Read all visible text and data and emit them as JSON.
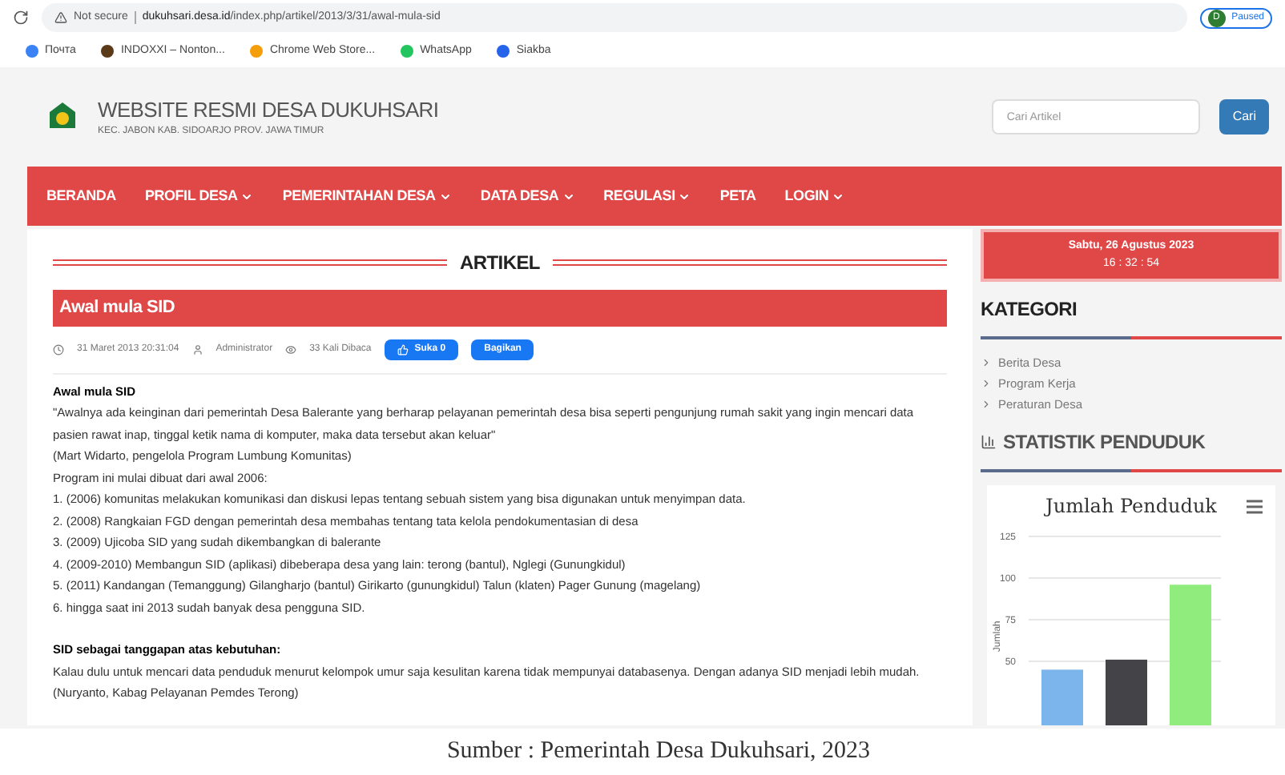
{
  "browser": {
    "security": "Not secure",
    "url_host": "dukuhsari.desa.id",
    "url_path": "/index.php/artikel/2013/3/31/awal-mula-sid",
    "profile_initial": "D",
    "profile_status": "Paused",
    "bookmarks": [
      {
        "label": "Почта",
        "color": "#3b82f6"
      },
      {
        "label": "INDOXXI – Nonton...",
        "color": "#5b3a1a"
      },
      {
        "label": "Chrome Web Store...",
        "color": "#f59e0b"
      },
      {
        "label": "WhatsApp",
        "color": "#22c55e"
      },
      {
        "label": "Siakba",
        "color": "#2563eb"
      }
    ]
  },
  "site": {
    "title": "WEBSITE RESMI DESA DUKUHSARI",
    "subtitle": "KEC. JABON KAB. SIDOARJO PROV. JAWA TIMUR",
    "search": {
      "placeholder": "Cari Artikel",
      "button": "Cari"
    }
  },
  "nav": [
    {
      "label": "BERANDA",
      "dropdown": false
    },
    {
      "label": "PROFIL DESA",
      "dropdown": true
    },
    {
      "label": "PEMERINTAHAN DESA",
      "dropdown": true
    },
    {
      "label": "DATA DESA",
      "dropdown": true
    },
    {
      "label": "REGULASI",
      "dropdown": true
    },
    {
      "label": "PETA",
      "dropdown": false
    },
    {
      "label": "LOGIN",
      "dropdown": true
    }
  ],
  "article": {
    "section": "ARTIKEL",
    "title": "Awal mula SID",
    "date": "31 Maret 2013 20:31:04",
    "author": "Administrator",
    "views": "33 Kali Dibaca",
    "like": "Suka 0",
    "share": "Bagikan",
    "body": [
      {
        "kind": "heading",
        "text": "Awal mula SID"
      },
      {
        "kind": "text",
        "text": "\"Awalnya ada keinginan dari pemerintah Desa Balerante yang berharap pelayanan pemerintah desa bisa seperti pengunjung rumah sakit yang ingin mencari data pasien rawat inap, tinggal ketik nama di komputer, maka data tersebut akan keluar\""
      },
      {
        "kind": "text",
        "text": "(Mart Widarto, pengelola Program Lumbung Komunitas)"
      },
      {
        "kind": "text",
        "text": "Program ini mulai dibuat dari awal 2006:"
      },
      {
        "kind": "text",
        "text": "1. (2006) komunitas melakukan komunikasi dan diskusi lepas tentang sebuah sistem yang bisa digunakan untuk menyimpan data."
      },
      {
        "kind": "text",
        "text": "2. (2008) Rangkaian FGD dengan pemerintah desa membahas tentang tata kelola pendokumentasian di desa"
      },
      {
        "kind": "text",
        "text": "3. (2009) Ujicoba SID yang sudah dikembangkan di balerante"
      },
      {
        "kind": "text",
        "text": "4. (2009-2010) Membangun SID (aplikasi) dibeberapa desa yang lain: terong (bantul), Nglegi (Gunungkidul)"
      },
      {
        "kind": "text",
        "text": "5. (2011) Kandangan (Temanggung) Gilangharjo (bantul) Girikarto (gunungkidul) Talun (klaten) Pager Gunung (magelang)"
      },
      {
        "kind": "text",
        "text": "6. hingga saat ini 2013 sudah banyak desa pengguna SID."
      },
      {
        "kind": "spacer"
      },
      {
        "kind": "heading",
        "text": "SID sebagai tanggapan atas kebutuhan:"
      },
      {
        "kind": "text",
        "text": "Kalau dulu untuk mencari data penduduk menurut kelompok umur saja kesulitan karena tidak mempunyai databasenya. Dengan adanya SID menjadi lebih mudah."
      },
      {
        "kind": "text",
        "text": "(Nuryanto, Kabag Pelayanan Pemdes Terong)"
      }
    ]
  },
  "sidebar": {
    "date": "Sabtu, 26 Agustus 2023",
    "time": "16 : 32 : 54",
    "category_title": "KATEGORI",
    "categories": [
      "Berita Desa",
      "Program Kerja",
      "Peraturan Desa"
    ],
    "stats_title": "STATISTIK PENDUDUK",
    "chart_data": {
      "type": "bar",
      "title": "Jumlah Penduduk",
      "ylabel": "Jumlah",
      "values": [
        45,
        51,
        96
      ],
      "colors": [
        "#7cb5ec",
        "#434348",
        "#90ed7d"
      ],
      "grid": true,
      "ylim": [
        0,
        125
      ],
      "yticks": [
        50,
        75,
        100,
        125
      ]
    }
  },
  "caption": "Sumber : Pemerintah Desa Dukuhsari, 2023"
}
